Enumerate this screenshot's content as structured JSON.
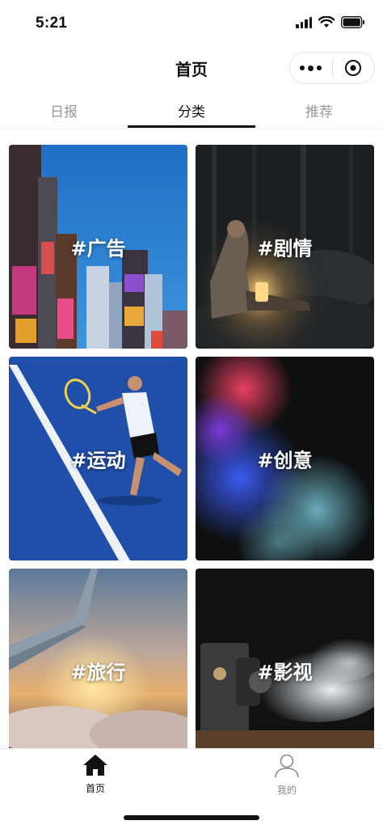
{
  "status_bar": {
    "time": "5:21"
  },
  "nav": {
    "title": "首页"
  },
  "tabs": [
    {
      "label": "日报",
      "active": false
    },
    {
      "label": "分类",
      "active": true
    },
    {
      "label": "推荐",
      "active": false
    }
  ],
  "categories": [
    {
      "label": "#广告",
      "image": "city-billboards-photo"
    },
    {
      "label": "#剧情",
      "image": "woman-with-lantern-photo"
    },
    {
      "label": "#运动",
      "image": "tennis-player-photo"
    },
    {
      "label": "#创意",
      "image": "colored-smoke-photo"
    },
    {
      "label": "#旅行",
      "image": "airplane-wing-sunset-photo"
    },
    {
      "label": "#影视",
      "image": "film-projector-photo"
    }
  ],
  "tabbar": {
    "home_label": "首页",
    "mine_label": "我的",
    "active_color": "#111111",
    "inactive_color": "#8a8a8a"
  }
}
